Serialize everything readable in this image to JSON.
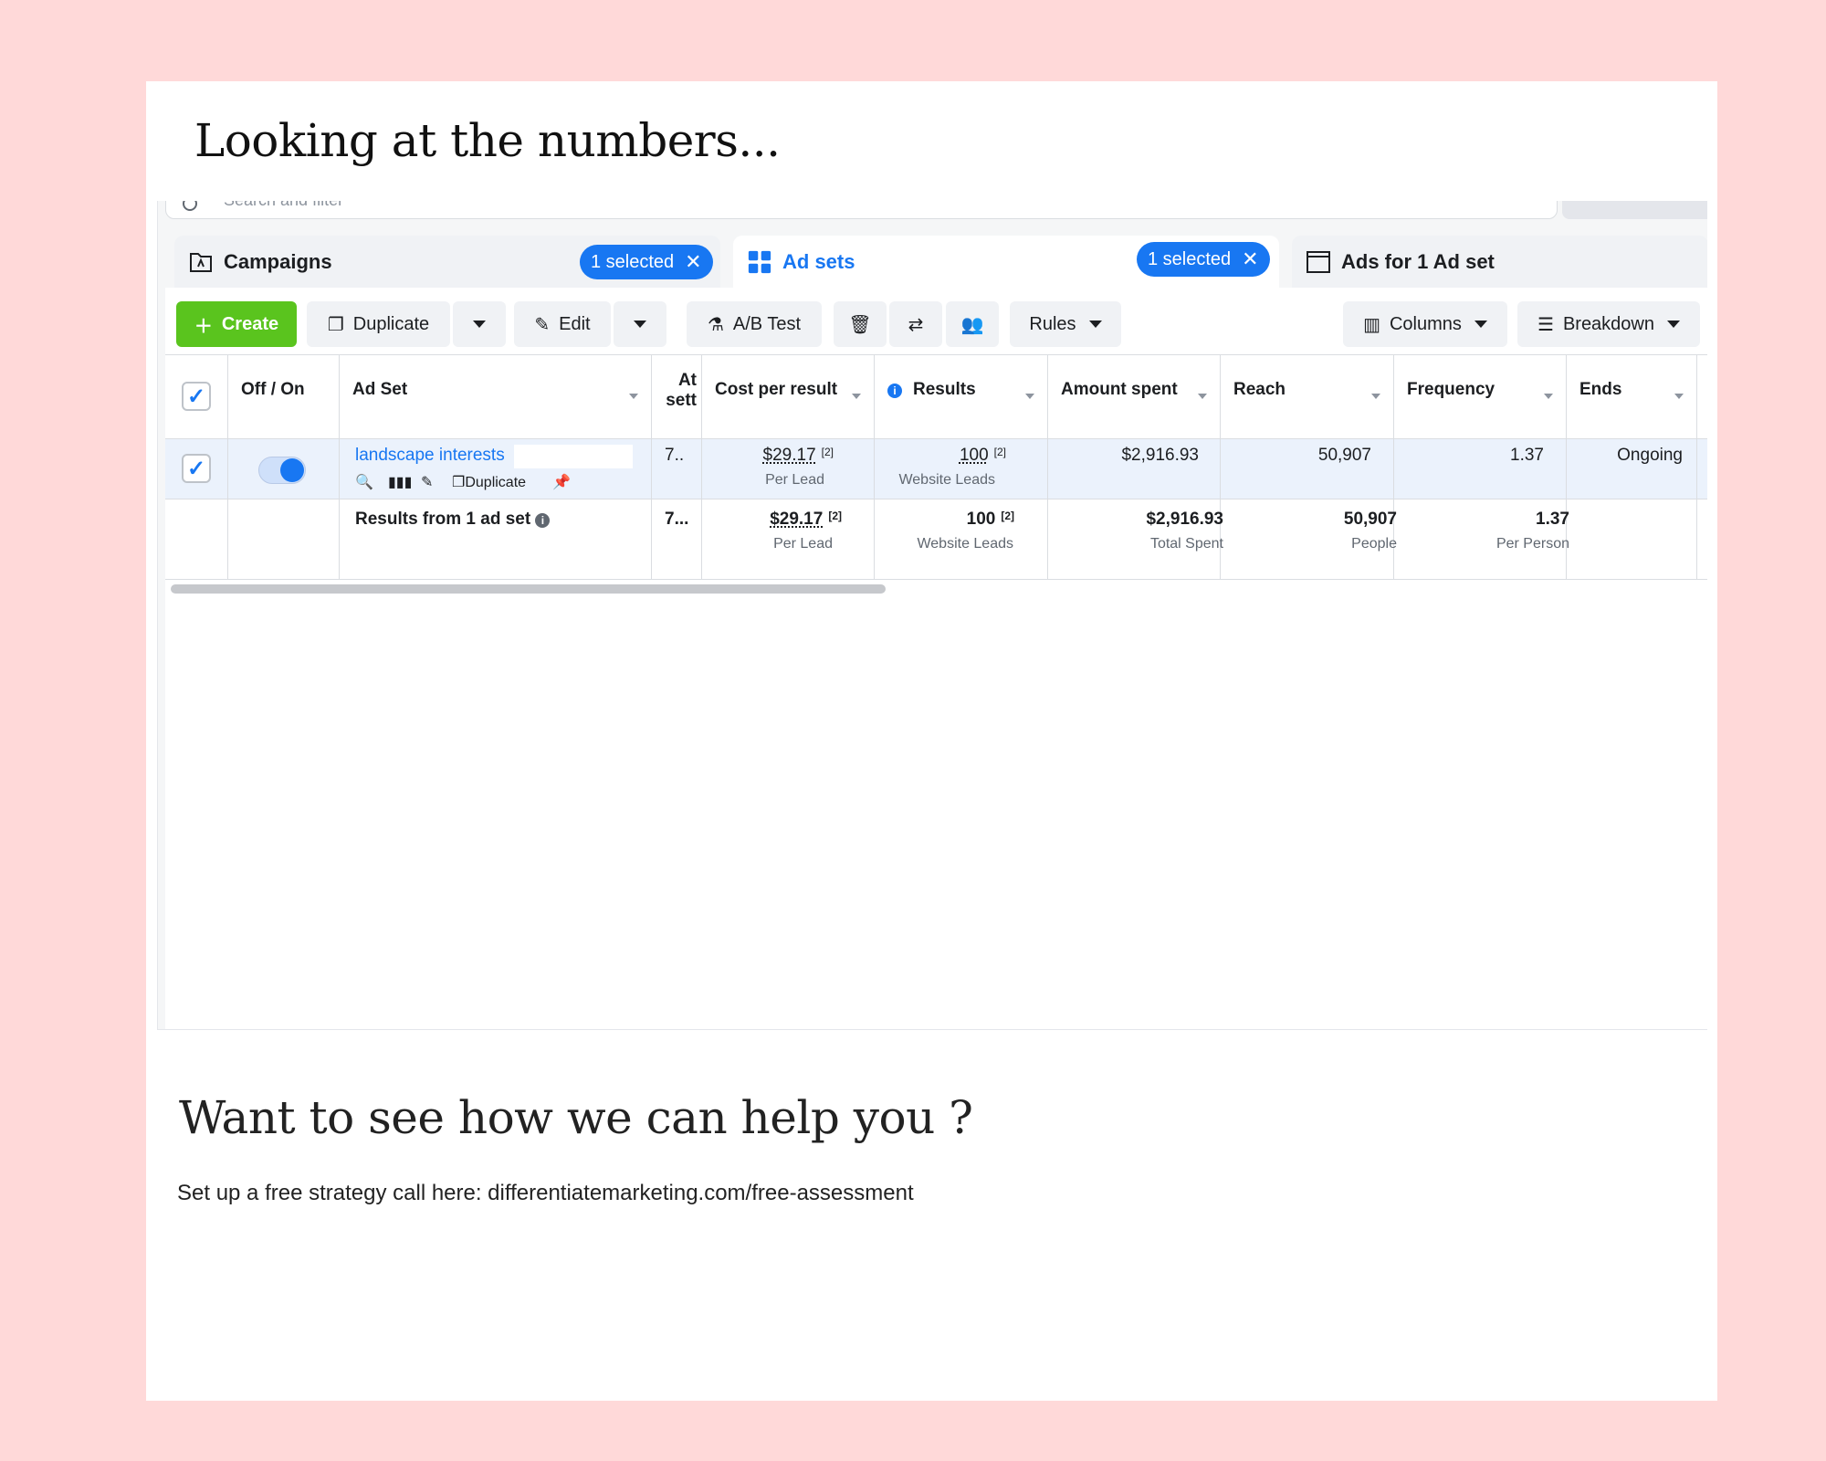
{
  "heading": "Looking at the numbers...",
  "search": {
    "placeholder": "Search and filter"
  },
  "tabs": [
    {
      "label": "Campaigns",
      "selected": "1 selected"
    },
    {
      "label": "Ad sets",
      "selected": "1 selected"
    },
    {
      "label": "Ads for 1 Ad set"
    }
  ],
  "toolbar": {
    "create": "Create",
    "duplicate": "Duplicate",
    "edit": "Edit",
    "ab_test": "A/B Test",
    "rules": "Rules",
    "columns": "Columns",
    "breakdown": "Breakdown"
  },
  "columns": {
    "off_on": "Off / On",
    "ad_set": "Ad Set",
    "attribution": "At sett",
    "cost_per_result": "Cost per result",
    "results": "Results",
    "amount_spent": "Amount spent",
    "reach": "Reach",
    "frequency": "Frequency",
    "ends": "Ends"
  },
  "row": {
    "name": "landscape interests",
    "duplicate": "Duplicate",
    "attribution": "7..",
    "cost": "$29.17",
    "cost_note": "[2]",
    "cost_sub": "Per Lead",
    "results": "100",
    "results_note": "[2]",
    "results_sub": "Website Leads",
    "amount": "$2,916.93",
    "reach": "50,907",
    "frequency": "1.37",
    "ends": "Ongoing"
  },
  "summary": {
    "label": "Results from 1 ad set",
    "attribution": "7...",
    "cost": "$29.17",
    "cost_note": "[2]",
    "cost_sub": "Per Lead",
    "results": "100",
    "results_note": "[2]",
    "results_sub": "Website Leads",
    "amount": "$2,916.93",
    "amount_sub": "Total Spent",
    "reach": "50,907",
    "reach_sub": "People",
    "frequency": "1.37",
    "frequency_sub": "Per Person"
  },
  "cta": {
    "heading": "Want to see how we can help you ?",
    "text": "Set up a free strategy call here: differentiatemarketing.com/free-assessment"
  },
  "colors": {
    "page_bg": "#ffd9d9",
    "accent": "#1877f2",
    "create_green": "#5ac41e"
  }
}
